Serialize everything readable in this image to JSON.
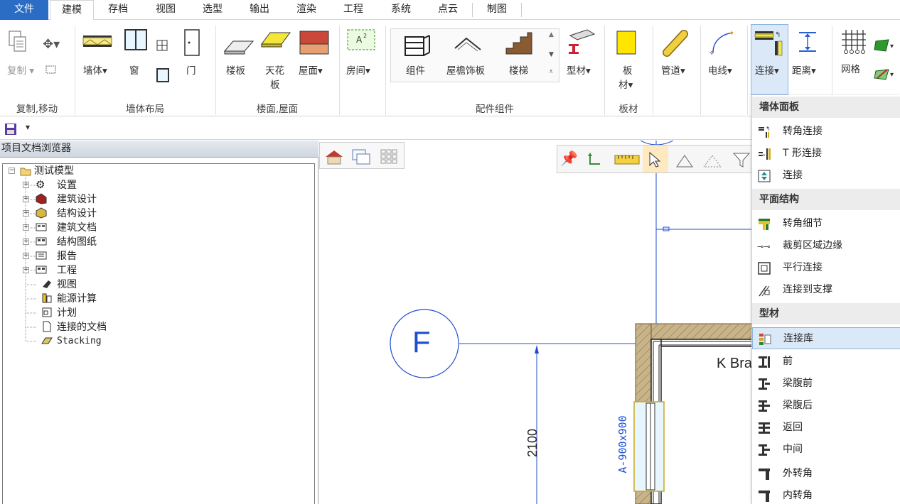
{
  "menu": {
    "tabs": [
      "文件",
      "建模",
      "存档",
      "视图",
      "选型",
      "输出",
      "渲染",
      "工程",
      "系统",
      "点云",
      "制图"
    ],
    "active": "建模"
  },
  "ribbon": {
    "copy_label": "复制",
    "wall_label": "墙体",
    "window_label": "窗",
    "door_label": "门",
    "slab_label": "楼板",
    "ceiling_label_1": "天花",
    "ceiling_label_2": "板",
    "roof_label": "屋面",
    "room_label": "房间",
    "component_label": "组件",
    "eave_label": "屋檐饰板",
    "stair_label": "楼梯",
    "profile_label": "型材",
    "panel_label_1": "板",
    "panel_label_2": "材",
    "pipe_label": "管道",
    "wire_label": "电线",
    "connect_label": "连接",
    "distance_label": "距离",
    "grid_label": "网格",
    "groups": {
      "copy_move": "复制,移动",
      "wall_layout": "墙体布局",
      "floor_roof": "楼面,屋面",
      "accessories": "配件组件",
      "panels": "板材"
    }
  },
  "browser": {
    "title": "项目文档浏览器",
    "root": "测试模型",
    "items": [
      "设置",
      "建筑设计",
      "结构设计",
      "建筑文档",
      "结构图纸",
      "报告",
      "工程",
      "视图",
      "能源计算",
      "计划",
      "连接的文档",
      "Stacking"
    ]
  },
  "canvas": {
    "grid_bubble": "F",
    "dim_vertical": "2100",
    "window_tag": "A-900x900",
    "room_label": "K Bra"
  },
  "dropdown": {
    "sections": [
      {
        "title": "墙体面板",
        "items": [
          "转角连接",
          "T 形连接",
          "连接"
        ]
      },
      {
        "title": "平面结构",
        "items": [
          "转角细节",
          "裁剪区域边缘",
          "平行连接",
          "连接到支撑"
        ]
      },
      {
        "title": "型材",
        "items": [
          "连接库",
          "前",
          "梁腹前",
          "梁腹后",
          "返回",
          "中间",
          "外转角",
          "内转角"
        ]
      }
    ],
    "selected": "连接库"
  },
  "colors": {
    "accent": "#2b6cc4",
    "selection": "#dbe8f7",
    "drawing": "#1f4fd0"
  }
}
